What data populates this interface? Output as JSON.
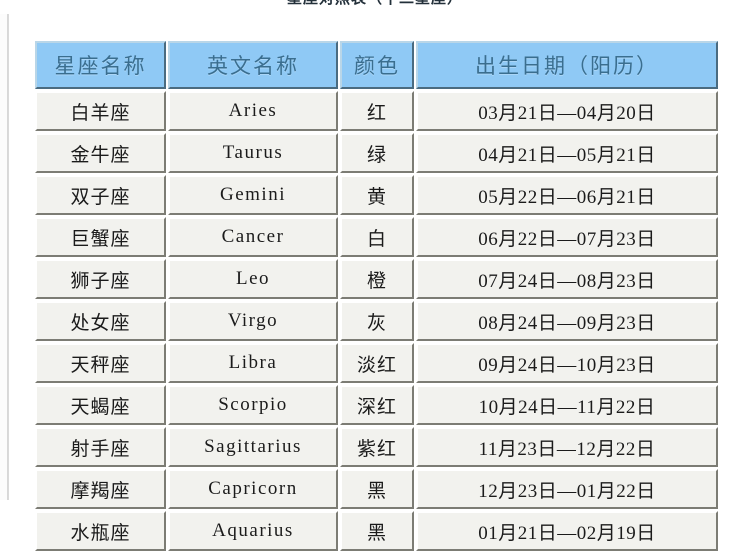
{
  "page": {
    "clipped_title": "星座对照表（十二星座）"
  },
  "table": {
    "headers": [
      "星座名称",
      "英文名称",
      "颜色",
      "出生日期（阳历）"
    ],
    "rows": [
      {
        "cn": "白羊座",
        "en": "Aries",
        "color": "红",
        "dates": "03月21日—04月20日"
      },
      {
        "cn": "金牛座",
        "en": "Taurus",
        "color": "绿",
        "dates": "04月21日—05月21日"
      },
      {
        "cn": "双子座",
        "en": "Gemini",
        "color": "黄",
        "dates": "05月22日—06月21日"
      },
      {
        "cn": "巨蟹座",
        "en": "Cancer",
        "color": "白",
        "dates": "06月22日—07月23日"
      },
      {
        "cn": "狮子座",
        "en": "Leo",
        "color": "橙",
        "dates": "07月24日—08月23日"
      },
      {
        "cn": "处女座",
        "en": "Virgo",
        "color": "灰",
        "dates": "08月24日—09月23日"
      },
      {
        "cn": "天秤座",
        "en": "Libra",
        "color": "淡红",
        "dates": "09月24日—10月23日"
      },
      {
        "cn": "天蝎座",
        "en": "Scorpio",
        "color": "深红",
        "dates": "10月24日—11月22日"
      },
      {
        "cn": "射手座",
        "en": "Sagittarius",
        "color": "紫红",
        "dates": "11月23日—12月22日"
      },
      {
        "cn": "摩羯座",
        "en": "Capricorn",
        "color": "黑",
        "dates": "12月23日—01月22日"
      },
      {
        "cn": "水瓶座",
        "en": "Aquarius",
        "color": "黑",
        "dates": "01月21日—02月19日"
      }
    ]
  },
  "colors": {
    "header_fill": "#8fc9f5",
    "header_text": "#3a6e8f",
    "cell_fill": "#f2f2ee",
    "cell_text": "#1b1b1b",
    "page_bg": "#ffffff"
  }
}
